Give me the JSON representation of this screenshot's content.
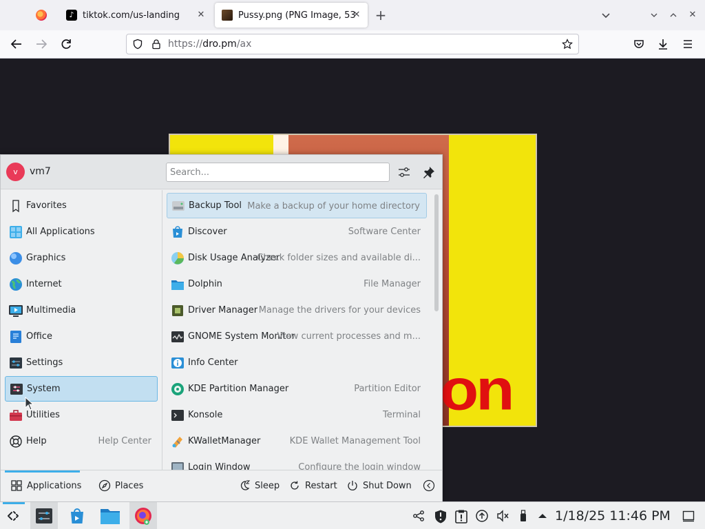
{
  "browser": {
    "tabs": [
      {
        "title": "",
        "favicon": "firefox-icon"
      },
      {
        "title": "tiktok.com/us-landing",
        "favicon": "tiktok-icon"
      },
      {
        "title": "Pussy.png (PNG Image, 53",
        "favicon": "image-icon",
        "active": true
      }
    ],
    "url_scheme": "https://",
    "url_host": "dro.pm",
    "url_path": "/ax"
  },
  "launcher": {
    "user": {
      "name": "vm7",
      "initial": "v",
      "avatar_color": "#e93a58"
    },
    "search_placeholder": "Search...",
    "categories": [
      {
        "label": "Favorites",
        "icon": "bookmark-icon",
        "desc": ""
      },
      {
        "label": "All Applications",
        "icon": "grid-icon",
        "desc": ""
      },
      {
        "label": "Graphics",
        "icon": "graphics-icon",
        "desc": ""
      },
      {
        "label": "Internet",
        "icon": "globe-icon",
        "desc": ""
      },
      {
        "label": "Multimedia",
        "icon": "multimedia-icon",
        "desc": ""
      },
      {
        "label": "Office",
        "icon": "office-icon",
        "desc": ""
      },
      {
        "label": "Settings",
        "icon": "settings-icon",
        "desc": ""
      },
      {
        "label": "System",
        "icon": "system-icon",
        "desc": "",
        "selected": true
      },
      {
        "label": "Utilities",
        "icon": "toolbox-icon",
        "desc": ""
      },
      {
        "label": "Help",
        "icon": "lifebuoy-icon",
        "desc": "Help Center"
      }
    ],
    "apps": [
      {
        "label": "Backup Tool",
        "desc": "Make a backup of your home directory",
        "icon": "backup-icon",
        "hover": true
      },
      {
        "label": "Discover",
        "desc": "Software Center",
        "icon": "discover-icon"
      },
      {
        "label": "Disk Usage Analyzer",
        "desc": "Check folder sizes and available di...",
        "icon": "disk-usage-icon"
      },
      {
        "label": "Dolphin",
        "desc": "File Manager",
        "icon": "folder-icon"
      },
      {
        "label": "Driver Manager",
        "desc": "Manage the drivers for your devices",
        "icon": "chip-icon"
      },
      {
        "label": "GNOME System Monitor",
        "desc": "View current processes and m...",
        "icon": "monitor-icon"
      },
      {
        "label": "Info Center",
        "desc": "",
        "icon": "info-icon"
      },
      {
        "label": "KDE Partition Manager",
        "desc": "Partition Editor",
        "icon": "partition-icon"
      },
      {
        "label": "Konsole",
        "desc": "Terminal",
        "icon": "terminal-icon"
      },
      {
        "label": "KWalletManager",
        "desc": "KDE Wallet Management Tool",
        "icon": "wallet-icon"
      },
      {
        "label": "Login Window",
        "desc": "Configure the login window",
        "icon": "login-icon"
      }
    ],
    "footer": {
      "applications": "Applications",
      "places": "Places",
      "sleep": "Sleep",
      "restart": "Restart",
      "shutdown": "Shut Down"
    }
  },
  "taskbar": {
    "clock": "1/18/25 11:46 PM",
    "accent": "#3daee9"
  }
}
